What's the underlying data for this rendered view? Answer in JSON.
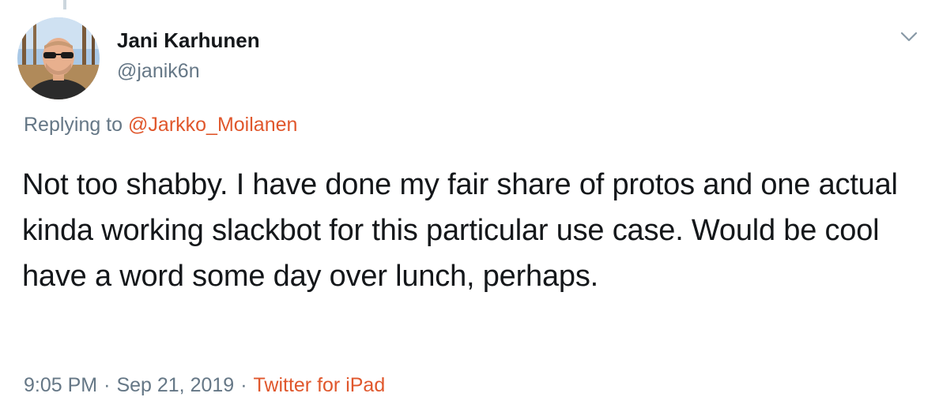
{
  "author": {
    "name": "Jani Karhunen",
    "handle": "@janik6n"
  },
  "reply": {
    "prefix": "Replying to",
    "mention": "@Jarkko_Moilanen"
  },
  "tweet": {
    "text": "Not too shabby. I have done my fair share of protos and one actual kinda working slackbot for this particular use case. Would be cool have a word some day over lunch, perhaps."
  },
  "meta": {
    "time": "9:05 PM",
    "separator": "·",
    "date": "Sep 21, 2019",
    "source": "Twitter for iPad"
  },
  "icons": {
    "menu": "chevron-down-icon"
  },
  "colors": {
    "accent": "#e0572c",
    "secondary_text": "#657786",
    "primary_text": "#14171a"
  }
}
